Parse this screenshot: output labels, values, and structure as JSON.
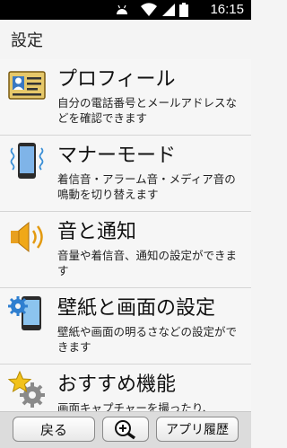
{
  "status_bar": {
    "time": "16:15"
  },
  "header": {
    "title": "設定"
  },
  "items": [
    {
      "icon": "profile-card-icon",
      "label": "プロフィール",
      "description": "自分の電話番号とメールアドレスなどを確認できます"
    },
    {
      "icon": "phone-vibrate-icon",
      "label": "マナーモード",
      "description": "着信音・アラーム音・メディア音の鳴動を切り替えます"
    },
    {
      "icon": "speaker-icon",
      "label": "音と通知",
      "description": "音量や着信音、通知の設定ができます"
    },
    {
      "icon": "phone-gear-icon",
      "label": "壁紙と画面の設定",
      "description": "壁紙や画面の明るさなどの設定ができます"
    },
    {
      "icon": "star-gear-icon",
      "label": "おすすめ機能",
      "description": "画面キャプチャーを撮ったり、"
    }
  ],
  "bottom_bar": {
    "back_label": "戻る",
    "history_label": "アプリ履歴"
  }
}
